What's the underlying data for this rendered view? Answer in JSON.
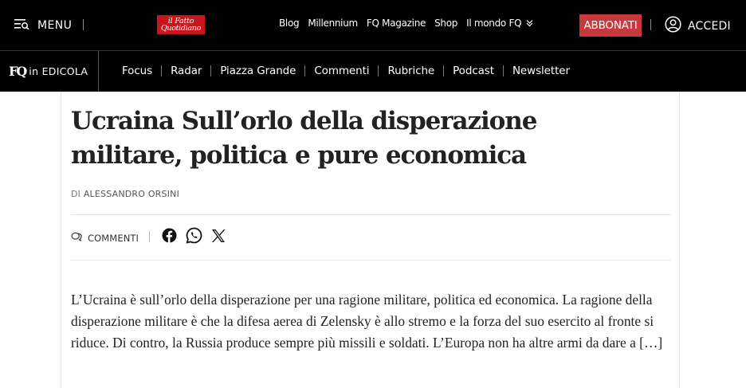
{
  "header": {
    "menu_label": "MENU",
    "logo": {
      "line1": "il Fatto",
      "line2": "Quotidiano"
    },
    "links": [
      {
        "label": "Blog"
      },
      {
        "label": "Millennium"
      },
      {
        "label": "FQ Magazine"
      },
      {
        "label": "Shop"
      },
      {
        "label": "Il mondo FQ"
      }
    ],
    "subscribe_label": "ABBONATI",
    "login_label": "ACCEDI"
  },
  "subnav": {
    "edicola_mark": "FQ",
    "edicola_label": "in EDICOLA",
    "items": [
      {
        "label": "Focus"
      },
      {
        "label": "Radar"
      },
      {
        "label": "Piazza Grande"
      },
      {
        "label": "Commenti"
      },
      {
        "label": "Rubriche"
      },
      {
        "label": "Podcast"
      },
      {
        "label": "Newsletter"
      }
    ]
  },
  "article": {
    "title": "Ucraina Sull’orlo della disperazione militare, politica e pure economica",
    "byline_prefix": "DI",
    "author": "ALESSANDRO ORSINI",
    "comments_label": "COMMENTI",
    "share_icons": [
      "facebook-icon",
      "whatsapp-icon",
      "x-icon"
    ],
    "lead": "L’Ucraina è sull’orlo della disperazione per una ragione militare, politica ed economica. La ragione della disperazione militare è che la difesa aerea di Zelensky è allo stremo e la forza del suo esercito al fronte si riduce. Di contro, la Russia produce sempre più missili e soldati. L’Europa non ha altre armi da dare a",
    "lead_more": "[…]"
  },
  "colors": {
    "header_bg": "#000000",
    "subscribe_bg": "#c8393e",
    "logo_bg": "#c8161d",
    "title_text": "#222222"
  }
}
